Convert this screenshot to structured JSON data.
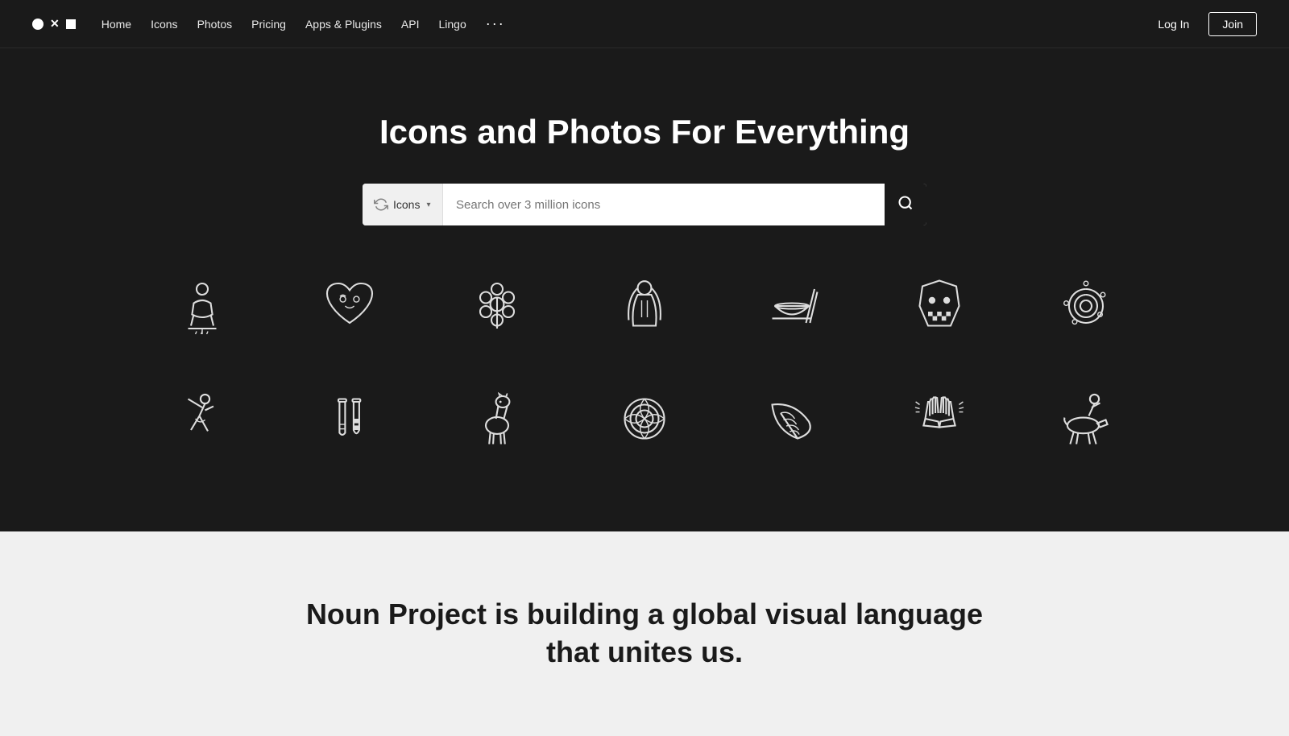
{
  "nav": {
    "logo": {
      "shapes": [
        "circle",
        "x",
        "square"
      ]
    },
    "links": [
      {
        "label": "Home",
        "name": "home"
      },
      {
        "label": "Icons",
        "name": "icons"
      },
      {
        "label": "Photos",
        "name": "photos"
      },
      {
        "label": "Pricing",
        "name": "pricing"
      },
      {
        "label": "Apps & Plugins",
        "name": "apps-plugins"
      },
      {
        "label": "API",
        "name": "api"
      },
      {
        "label": "Lingo",
        "name": "lingo"
      }
    ],
    "more_label": "···",
    "login_label": "Log In",
    "join_label": "Join"
  },
  "hero": {
    "title": "Icons and Photos For Everything",
    "search": {
      "type_label": "Icons",
      "placeholder": "Search over 3 million icons",
      "button_aria": "Search"
    }
  },
  "bottom": {
    "headline_line1": "Noun Project is building a global visual language",
    "headline_line2": "that unites us."
  }
}
